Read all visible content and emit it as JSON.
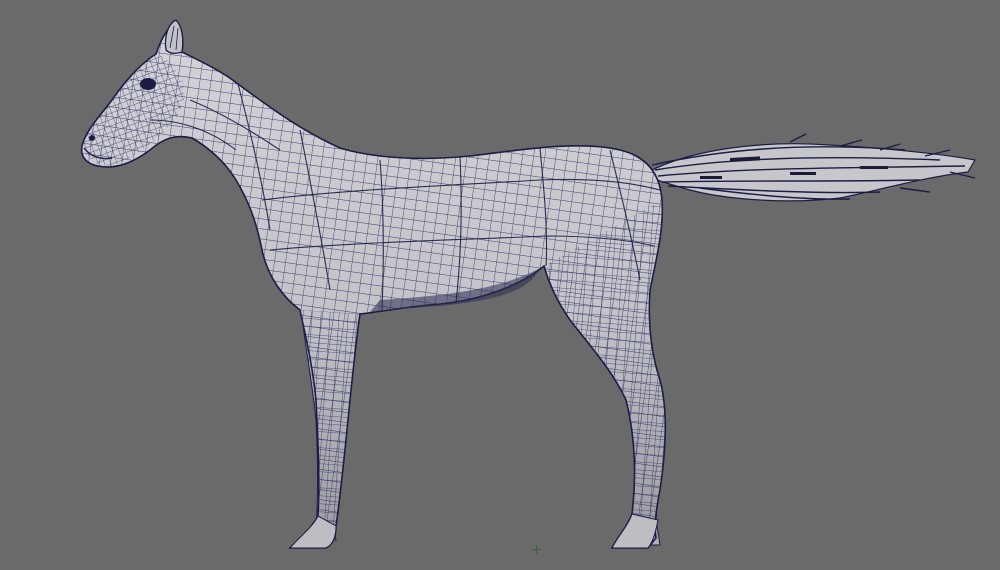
{
  "viewport": {
    "background_color": "#6a6a6a",
    "model": {
      "subject": "horse",
      "display_mode": "wireframe-on-shaded",
      "surface_color": "#c9c9cc",
      "shadow_color": "#8e8e93",
      "wire_color": "#23265e",
      "parts": [
        "head",
        "ear",
        "neck",
        "body",
        "front-leg",
        "rear-leg",
        "hoof",
        "tail"
      ]
    },
    "origin_marker": {
      "icon": "origin-axis-icon",
      "color": "#2e6a3c"
    }
  }
}
